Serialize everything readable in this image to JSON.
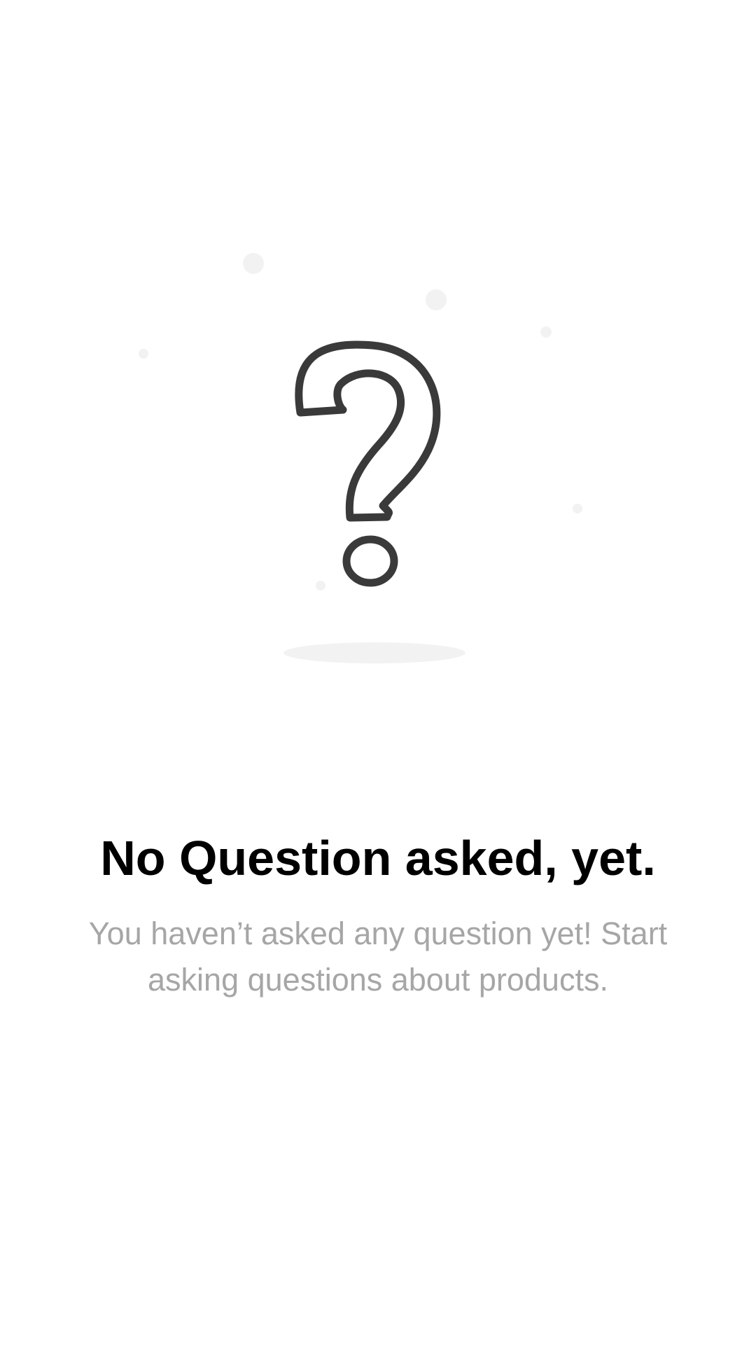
{
  "empty_state": {
    "icon": "question-mark-icon",
    "title": "No Question asked, yet.",
    "description": "You haven’t asked any question yet! Start asking questions about products."
  },
  "colors": {
    "background": "#ffffff",
    "icon_stroke": "#3a3a3a",
    "decoration": "#f2f2f2",
    "title": "#000000",
    "description": "#a6a6a6"
  }
}
